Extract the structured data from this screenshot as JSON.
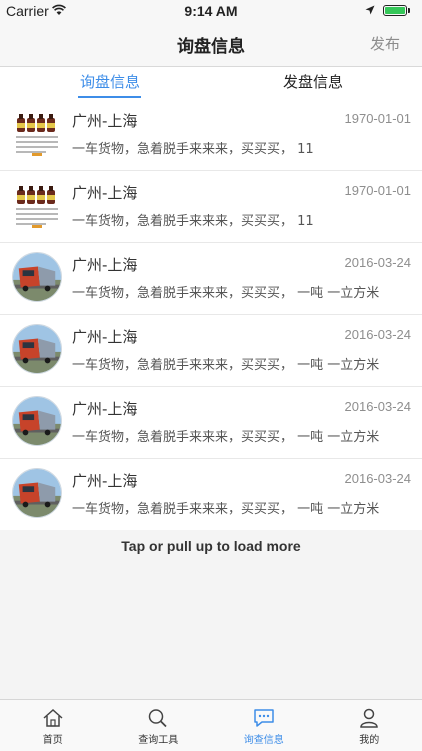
{
  "status_bar": {
    "carrier": "Carrier",
    "time": "9:14 AM"
  },
  "nav": {
    "title": "询盘信息",
    "publish_label": "发布"
  },
  "segments": [
    {
      "label": "询盘信息",
      "active": true
    },
    {
      "label": "发盘信息",
      "active": false
    }
  ],
  "list": [
    {
      "thumb": "product-bottles",
      "route": "广州-上海",
      "date": "1970-01-01",
      "desc": "一车货物，急着脱手来来来，买买买， 11"
    },
    {
      "thumb": "product-bottles",
      "route": "广州-上海",
      "date": "1970-01-01",
      "desc": "一车货物，急着脱手来来来，买买买， 11"
    },
    {
      "thumb": "truck-avatar",
      "route": "广州-上海",
      "date": "2016-03-24",
      "desc": "一车货物，急着脱手来来来，买买买， 一吨 一立方米"
    },
    {
      "thumb": "truck-avatar",
      "route": "广州-上海",
      "date": "2016-03-24",
      "desc": "一车货物，急着脱手来来来，买买买， 一吨 一立方米"
    },
    {
      "thumb": "truck-avatar",
      "route": "广州-上海",
      "date": "2016-03-24",
      "desc": "一车货物，急着脱手来来来，买买买， 一吨 一立方米"
    },
    {
      "thumb": "truck-avatar",
      "route": "广州-上海",
      "date": "2016-03-24",
      "desc": "一车货物，急着脱手来来来，买买买， 一吨 一立方米"
    }
  ],
  "load_more": "Tap or pull up to load more",
  "tabbar": [
    {
      "label": "首页",
      "icon": "home-icon",
      "active": false
    },
    {
      "label": "查询工具",
      "icon": "search-icon",
      "active": false
    },
    {
      "label": "询查信息",
      "icon": "chat-icon",
      "active": true
    },
    {
      "label": "我的",
      "icon": "person-icon",
      "active": false
    }
  ],
  "colors": {
    "accent": "#3d8de8",
    "muted": "#8e8e8e"
  }
}
